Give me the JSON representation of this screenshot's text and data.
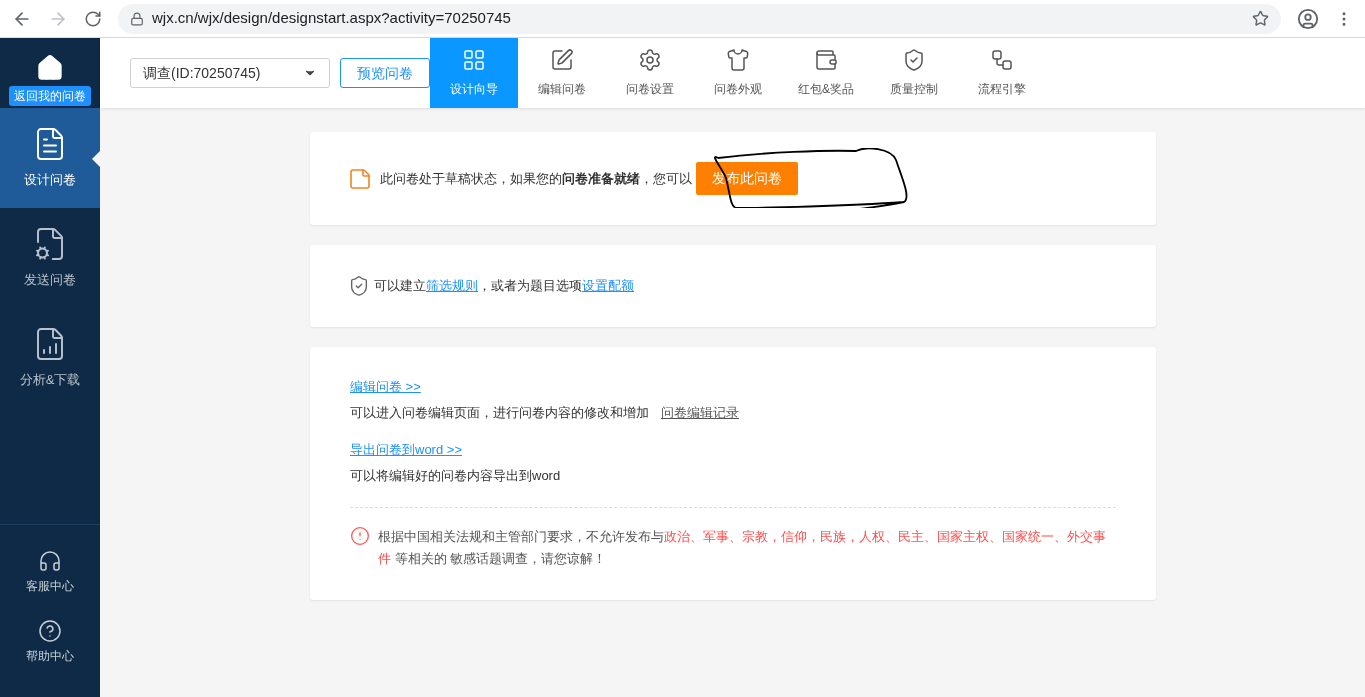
{
  "browser": {
    "url": "wjx.cn/wjx/design/designstart.aspx?activity=70250745"
  },
  "sidebar": {
    "home_label": "返回我的问卷",
    "items": [
      {
        "label": "设计问卷",
        "selected": true
      },
      {
        "label": "发送问卷",
        "selected": false
      },
      {
        "label": "分析&下载",
        "selected": false
      }
    ],
    "bottom_items": [
      {
        "label": "客服中心"
      },
      {
        "label": "帮助中心"
      }
    ]
  },
  "header": {
    "survey_select": "调查(ID:70250745)",
    "preview_button": "预览问卷",
    "tabs": [
      {
        "label": "设计向导",
        "selected": true
      },
      {
        "label": "编辑问卷",
        "selected": false
      },
      {
        "label": "问卷设置",
        "selected": false
      },
      {
        "label": "问卷外观",
        "selected": false
      },
      {
        "label": "红包&奖品",
        "selected": false
      },
      {
        "label": "质量控制",
        "selected": false
      },
      {
        "label": "流程引擎",
        "selected": false
      }
    ]
  },
  "status_card": {
    "text": "此问卷处于草稿状态，如果您的**问卷准备就绪**，您可以",
    "publish_button": "发布此问卷"
  },
  "rules_card": {
    "segments": [
      {
        "text": "可以建立",
        "link": false
      },
      {
        "text": "筛选规则",
        "link": true
      },
      {
        "text": "，或者为题目选项",
        "link": false
      },
      {
        "text": "设置配额",
        "link": true
      }
    ]
  },
  "actions_card": {
    "edit_link": "编辑问卷 >>",
    "edit_desc": "可以进入问卷编辑页面，进行问卷内容的修改和增加",
    "history_link": "问卷编辑记录",
    "export_link": "导出问卷到word >>",
    "export_desc": "可以将编辑好的问卷内容导出到word",
    "notice": [
      {
        "text": "根据中国相关法规和主管部门要求，不允许发布与",
        "highlight": false
      },
      {
        "text": "政治、军事、宗教，信仰，民族，人权、民主、国家主权、国家统一、外交事件",
        "highlight": true
      },
      {
        "text": " 等相关的 敏感话题调查，请您谅解！",
        "highlight": false
      }
    ]
  }
}
